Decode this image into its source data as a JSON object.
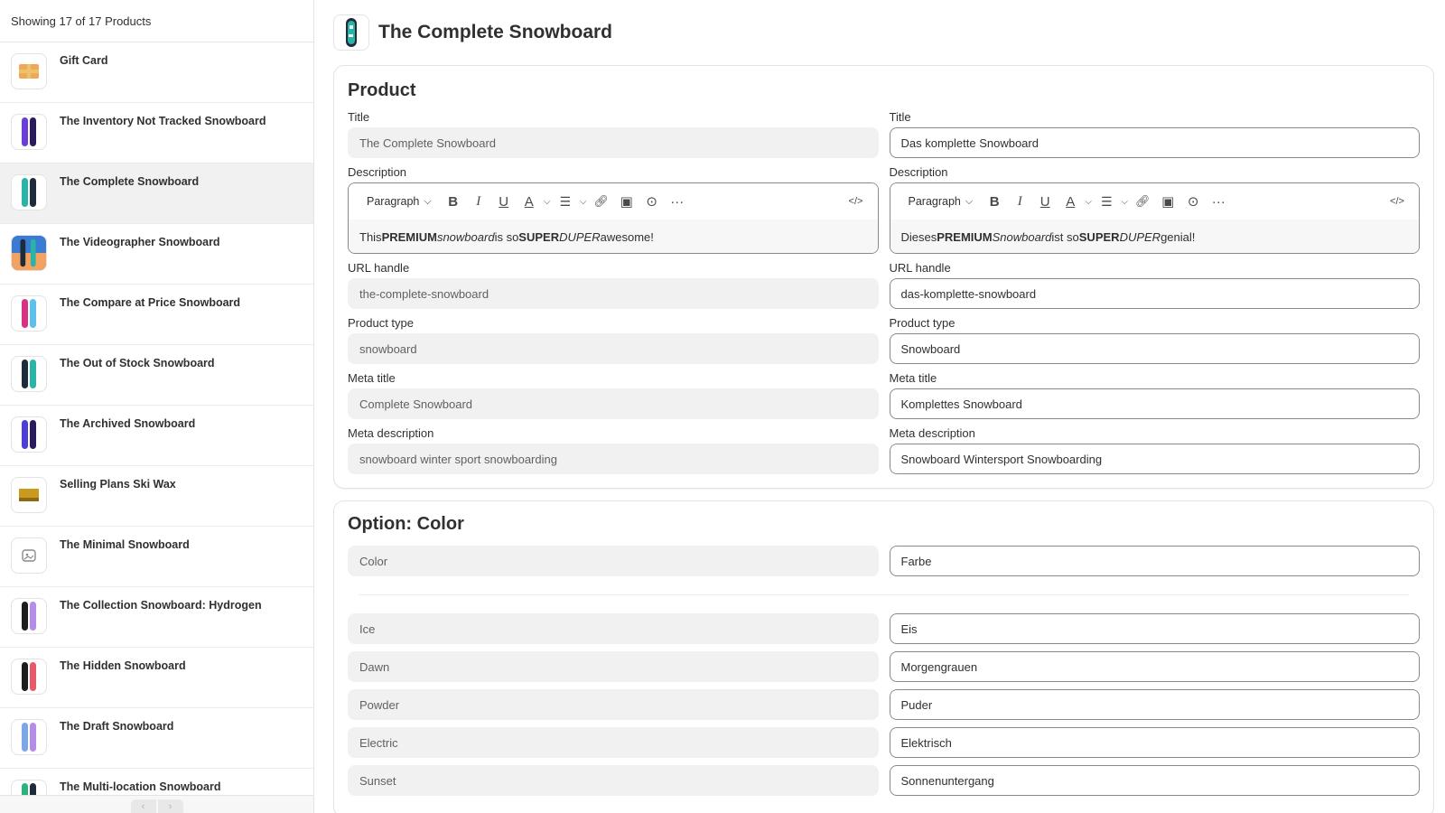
{
  "sidebar": {
    "header": "Showing 17 of 17 Products",
    "items": [
      {
        "label": "Gift Card",
        "thumb": "gift-card-thumbnail",
        "colors": [
          "#f2a65a",
          "#e9c46a"
        ]
      },
      {
        "label": "The Inventory Not Tracked Snowboard",
        "thumb": "purple-snowboard-thumbnail",
        "colors": [
          "#6a3fd8",
          "#2a1a5e"
        ]
      },
      {
        "label": "The Complete Snowboard",
        "thumb": "teal-snowboard-thumbnail",
        "colors": [
          "#2ab3a6",
          "#1d2b3a"
        ],
        "selected": true
      },
      {
        "label": "The Videographer Snowboard",
        "thumb": "photo-snowboard-thumbnail",
        "colors": [
          "#3a7bd5",
          "#f4a261"
        ]
      },
      {
        "label": "The Compare at Price Snowboard",
        "thumb": "pink-snowboard-thumbnail",
        "colors": [
          "#d63384",
          "#5bc0eb"
        ]
      },
      {
        "label": "The Out of Stock Snowboard",
        "thumb": "dark-teal-snowboard-thumbnail",
        "colors": [
          "#1d2b3a",
          "#2ab3a6"
        ]
      },
      {
        "label": "The Archived Snowboard",
        "thumb": "blue-purple-snowboard-thumbnail",
        "colors": [
          "#4b3fd8",
          "#2a1a5e"
        ]
      },
      {
        "label": "Selling Plans Ski Wax",
        "thumb": "ski-wax-thumbnail",
        "colors": [
          "#c99a1c",
          "#8a6a12"
        ]
      },
      {
        "label": "The Minimal Snowboard",
        "thumb": "image-placeholder-thumbnail",
        "colors": [
          "#ffffff",
          "#8a8a8a"
        ]
      },
      {
        "label": "The Collection Snowboard: Hydrogen",
        "thumb": "hydrogen-snowboard-thumbnail",
        "colors": [
          "#1d1d1d",
          "#b58ce8"
        ]
      },
      {
        "label": "The Hidden Snowboard",
        "thumb": "hidden-snowboard-thumbnail",
        "colors": [
          "#1d1d1d",
          "#e85a6a"
        ]
      },
      {
        "label": "The Draft Snowboard",
        "thumb": "draft-snowboard-thumbnail",
        "colors": [
          "#7aa7e8",
          "#b58ce8"
        ]
      },
      {
        "label": "The Multi-location Snowboard",
        "thumb": "multi-location-snowboard-thumbnail",
        "colors": [
          "#2ab37a",
          "#1d2b3a"
        ]
      }
    ],
    "pager": {
      "prev": "‹",
      "next": "›"
    }
  },
  "header": {
    "title": "The Complete Snowboard"
  },
  "product_card": {
    "title": "Product",
    "title_label": "Title",
    "title_source": "The Complete Snowboard",
    "title_translation": "Das komplette Snowboard",
    "description_label": "Description",
    "toolbar": {
      "paragraph": "Paragraph",
      "bold": "B",
      "italic": "I",
      "underline": "U",
      "color": "A",
      "more": "···",
      "code": "</>"
    },
    "description_source": {
      "before": "This ",
      "bold1": "PREMIUM",
      "sp1": " ",
      "italic1": "snowboard",
      "mid": " is so ",
      "bold2": "SUPER",
      "italic2": "DUPER",
      "after": " awesome!"
    },
    "description_translation": {
      "before": "Dieses ",
      "bold1": "PREMIUM",
      "sp1": " ",
      "italic1": "Snowboard",
      "mid": " ist so ",
      "bold2": "SUPER",
      "italic2": "DUPER",
      "after": " genial!"
    },
    "url_label": "URL handle",
    "url_source": "the-complete-snowboard",
    "url_translation": "das-komplette-snowboard",
    "type_label": "Product type",
    "type_source": "snowboard",
    "type_translation": "Snowboard",
    "meta_title_label": "Meta title",
    "meta_title_source": "Complete Snowboard",
    "meta_title_translation": "Komplettes Snowboard",
    "meta_desc_label": "Meta description",
    "meta_desc_source": "snowboard winter sport snowboarding",
    "meta_desc_translation": "Snowboard Wintersport Snowboarding"
  },
  "option_card": {
    "title": "Option: Color",
    "name_source": "Color",
    "name_translation": "Farbe",
    "values": [
      {
        "source": "Ice",
        "translation": "Eis"
      },
      {
        "source": "Dawn",
        "translation": "Morgengrauen"
      },
      {
        "source": "Powder",
        "translation": "Puder"
      },
      {
        "source": "Electric",
        "translation": "Elektrisch"
      },
      {
        "source": "Sunset",
        "translation": "Sonnenuntergang"
      }
    ]
  },
  "colors": {
    "border": "#e3e3e3",
    "readonly_bg": "#f1f1f1",
    "selected_bg": "#f1f1f1",
    "text": "#303030"
  }
}
